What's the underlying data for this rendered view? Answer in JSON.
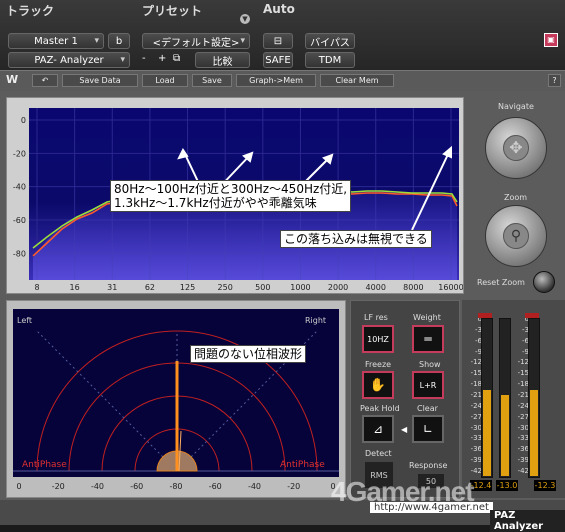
{
  "host": {
    "track_label": "トラック",
    "preset_label": "プリセット",
    "auto_label": "Auto",
    "track_name": "Master 1",
    "track_suffix": "b",
    "preset_value": "<デフォルト設定>",
    "bypass": "バイパス",
    "insert_name": "PAZ- Analyzer",
    "preset_minus": "-",
    "preset_plus": "+",
    "compare": "比較",
    "safe": "SAFE",
    "tdm": "TDM"
  },
  "toolbar": {
    "save_data": "Save Data",
    "load": "Load",
    "save": "Save",
    "graph_mem": "Graph->Mem",
    "clear_mem": "Clear Mem",
    "help": "?"
  },
  "spectrum": {
    "y_ticks": [
      "0",
      "-20",
      "-40",
      "-60",
      "-80"
    ],
    "x_ticks": [
      "8",
      "16",
      "31",
      "62",
      "125",
      "250",
      "500",
      "1000",
      "2000",
      "4000",
      "8000",
      "16000"
    ],
    "callout_main_line1": "80Hz～100Hz付近と300Hz～450Hz付近,",
    "callout_main_line2": "1.3kHz～1.7kHz付近がやや乖離気味",
    "callout_dip": "この落ち込みは無視できる"
  },
  "navigate": {
    "title": "Navigate",
    "zoom": "Zoom",
    "reset_zoom": "Reset Zoom"
  },
  "phase": {
    "left": "Left",
    "right": "Right",
    "anti_left": "AntiPhase",
    "anti_right": "AntiPhase",
    "x_ticks": [
      "0",
      "-20",
      "-40",
      "-60",
      "-80",
      "-60",
      "-40",
      "-20",
      "0"
    ],
    "callout": "問題のない位相波形"
  },
  "controls": {
    "lf_res": "LF res",
    "lf_res_value": "10HZ",
    "weight": "Weight",
    "freeze": "Freeze",
    "show": "Show",
    "show_value": "L+R",
    "peak_hold": "Peak Hold",
    "clear": "Clear",
    "detect": "Detect",
    "detect_value": "RMS",
    "response": "Response",
    "response_value": "50"
  },
  "meters": {
    "scale": [
      "0",
      "-3",
      "-6",
      "-9",
      "-12",
      "-15",
      "-18",
      "-21",
      "-24",
      "-27",
      "-30",
      "-33",
      "-36",
      "-39",
      "-42"
    ],
    "left_value": "-12.4",
    "mid_value": "-13.0",
    "right_value": "-12.3",
    "levels": [
      0.55,
      0.52,
      0.55
    ]
  },
  "footer": {
    "plugin_name": "PAZ Analyzer",
    "watermark": "4Gamer.net",
    "url": "http://www.4gamer.net"
  },
  "colors": {
    "spectrum_bg": "#0b0870",
    "phase_bg": "#05033a",
    "trace_green": "#9be03a",
    "trace_red": "#ff5a2a",
    "accent_pink": "#c43b5b",
    "meter_orange": "#e0a010"
  }
}
